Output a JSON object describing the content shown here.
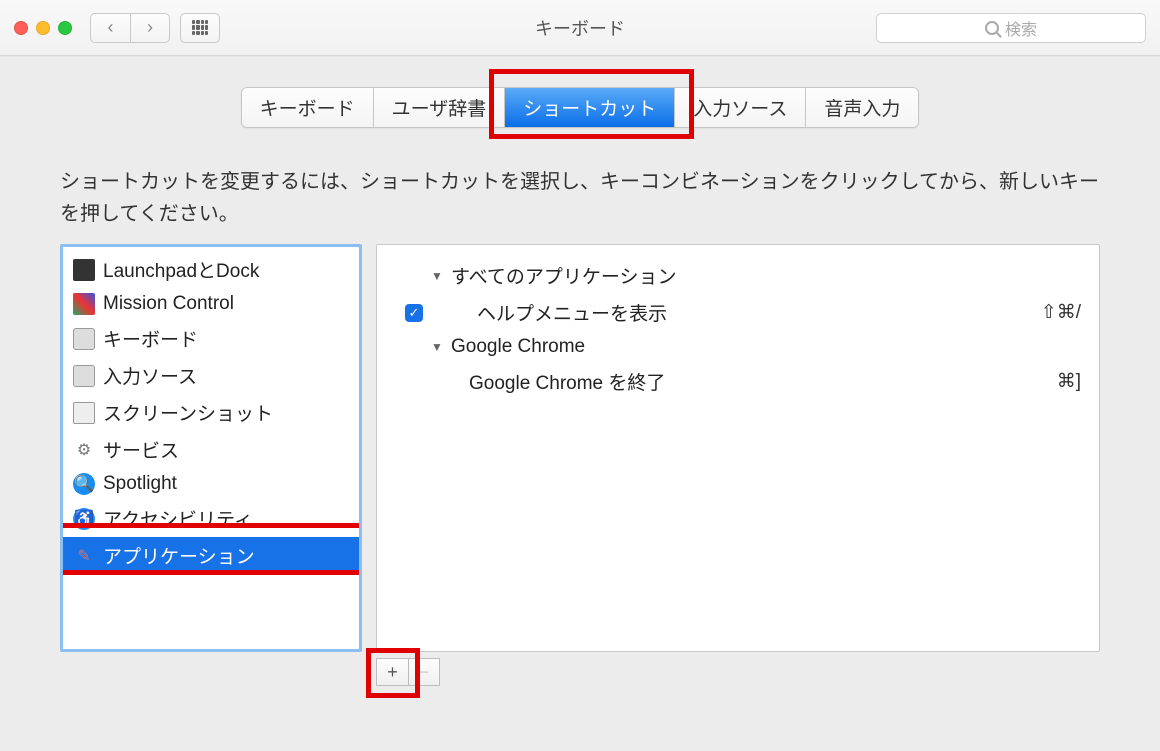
{
  "window": {
    "title": "キーボード"
  },
  "search": {
    "placeholder": "検索"
  },
  "tabs": [
    "キーボード",
    "ユーザ辞書",
    "ショートカット",
    "入力ソース",
    "音声入力"
  ],
  "active_tab": "ショートカット",
  "instruction": "ショートカットを変更するには、ショートカットを選択し、キーコンビネーションをクリックしてから、新しいキーを押してください。",
  "categories": [
    {
      "label": "LaunchpadとDock",
      "icon": "launchpad"
    },
    {
      "label": "Mission Control",
      "icon": "mission"
    },
    {
      "label": "キーボード",
      "icon": "keyboard"
    },
    {
      "label": "入力ソース",
      "icon": "input"
    },
    {
      "label": "スクリーンショット",
      "icon": "screenshot"
    },
    {
      "label": "サービス",
      "icon": "service"
    },
    {
      "label": "Spotlight",
      "icon": "spotlight"
    },
    {
      "label": "アクセシビリティ",
      "icon": "access"
    },
    {
      "label": "アプリケーション",
      "icon": "app",
      "selected": true
    }
  ],
  "tree": {
    "group1": {
      "label": "すべてのアプリケーション"
    },
    "item1": {
      "label": "ヘルプメニューを表示",
      "shortcut": "⇧⌘/",
      "checked": true
    },
    "group2": {
      "label": "Google Chrome"
    },
    "item2": {
      "label": "Google Chrome を終了",
      "shortcut": "⌘]"
    }
  },
  "buttons": {
    "add": "+",
    "remove": "−"
  }
}
